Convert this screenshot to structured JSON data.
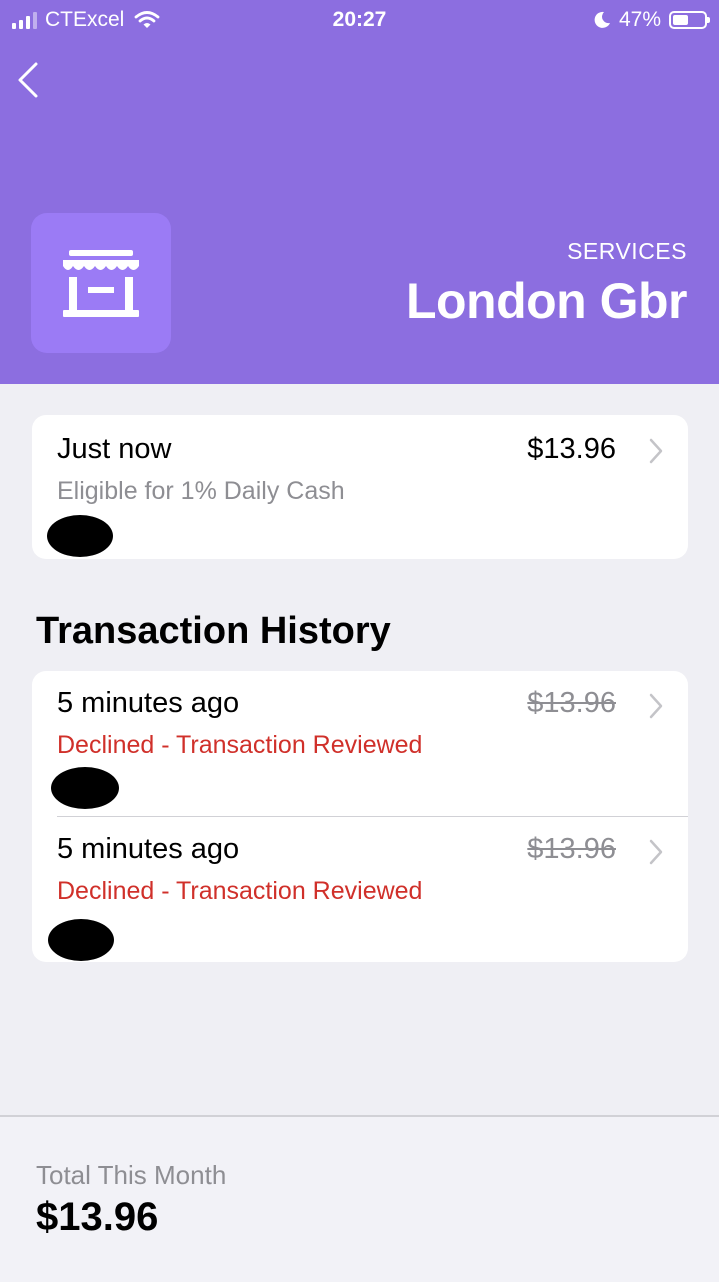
{
  "status_bar": {
    "carrier": "CTExcel",
    "time": "20:27",
    "battery": "47%"
  },
  "header": {
    "category": "SERVICES",
    "merchant": "London Gbr",
    "accent_color": "#8c6ee0",
    "icon": "storefront-icon"
  },
  "latest": {
    "time": "Just now",
    "subtitle": "Eligible for 1% Daily Cash",
    "amount": "$13.96"
  },
  "history": {
    "title": "Transaction History",
    "items": [
      {
        "time": "5 minutes ago",
        "status": "Declined - Transaction Reviewed",
        "amount": "$13.96"
      },
      {
        "time": "5 minutes ago",
        "status": "Declined - Transaction Reviewed",
        "amount": "$13.96"
      }
    ]
  },
  "footer": {
    "label": "Total This Month",
    "total": "$13.96"
  }
}
